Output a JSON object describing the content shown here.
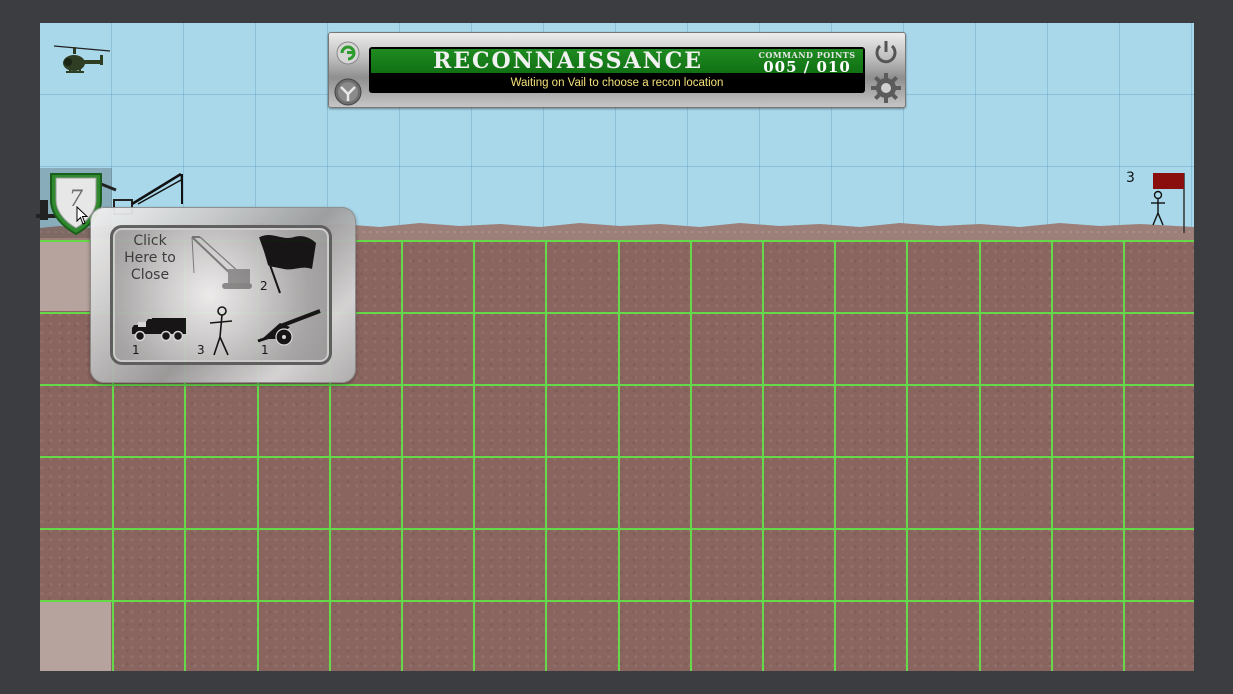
{
  "hud": {
    "title": "RECONNAISSANCE",
    "command_points_label": "COMMAND POINTS",
    "command_points_value": "005 / 010",
    "status": "Waiting on Vail to choose a recon location"
  },
  "base": {
    "badge_number": "7"
  },
  "popup": {
    "close_label": "Click Here to Close",
    "units": [
      {
        "name": "crane",
        "count": ""
      },
      {
        "name": "flag",
        "count": "2"
      },
      {
        "name": "truck",
        "count": "1"
      },
      {
        "name": "soldier",
        "count": "3"
      },
      {
        "name": "artillery",
        "count": "1"
      }
    ]
  },
  "enemy": {
    "count": "3",
    "flag_color": "#8b0e0e"
  },
  "colors": {
    "grid": "#66d94a",
    "dirt": "#8a6560",
    "sky": "#a8d8ea",
    "hud_green": "#1f8b21"
  }
}
